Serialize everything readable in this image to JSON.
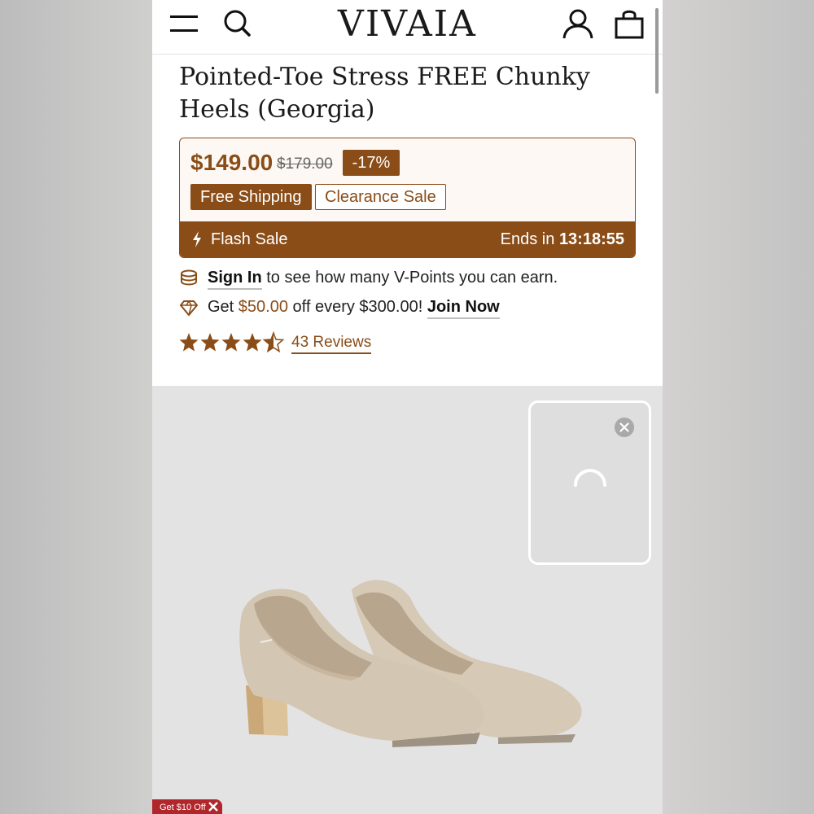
{
  "header": {
    "logo": "VIVAIA",
    "icons": [
      "menu-icon",
      "search-icon",
      "user-icon",
      "bag-icon"
    ]
  },
  "product": {
    "title": "Pointed-Toe Stress FREE Chunky Heels (Georgia)",
    "price": "$149.00",
    "old_price": "$179.00",
    "discount": "-17%",
    "tags": [
      "Free Shipping",
      "Clearance Sale"
    ],
    "flash_label": "Flash Sale",
    "ends_label": "Ends in",
    "ends_time": "13:18:55"
  },
  "points": {
    "sign_in": "Sign In",
    "sign_in_rest": " to see how many V-Points you can earn.",
    "get": "Get ",
    "amount": "$50.00",
    "off_text": " off every $300.00! ",
    "join": "Join Now"
  },
  "rating": {
    "stars": 4.5,
    "reviews": "43 Reviews"
  },
  "promo": {
    "label": "Get $10 Off"
  },
  "colors": {
    "accent": "#8a4d18",
    "promo": "#b0262b"
  }
}
